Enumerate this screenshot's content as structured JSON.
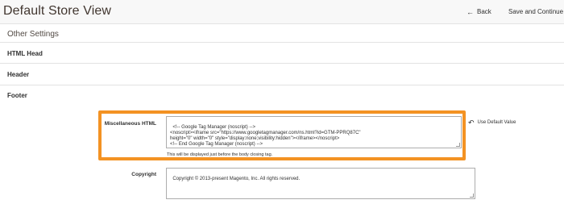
{
  "header": {
    "title": "Default Store View",
    "back_label": "Back",
    "back_icon": "arrow-left-icon",
    "save_label": "Save and Continue"
  },
  "sections": {
    "other_settings": "Other Settings",
    "html_head": "HTML Head",
    "header": "Header",
    "footer": "Footer"
  },
  "footer": {
    "misc_label": "Miscellaneous HTML",
    "misc_value": "<!-- Google Tag Manager (noscript) -->\n<noscript><iframe src=\"https://www.googletagmanager.com/ns.html?id=GTM-PPRQ87C\"\nheight=\"0\" width=\"0\" style=\"display:none;visibility:hidden\"></iframe></noscript>\n<!-- End Google Tag Manager (noscript) -->",
    "misc_note": "This will be displayed just before the body closing tag.",
    "use_default_label": "Use Default Value",
    "use_default_icon": "undo-icon",
    "copyright_label": "Copyright",
    "copyright_value": "Copyright © 2013-present Magento, Inc. All rights reserved."
  },
  "colors": {
    "highlight": "#f39223",
    "topbar_bg": "#f8f8f8"
  }
}
